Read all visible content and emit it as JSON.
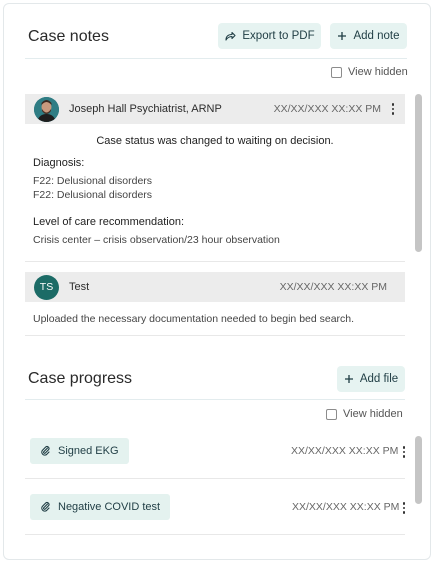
{
  "case_notes": {
    "title": "Case notes",
    "export_label": "Export to PDF",
    "add_note_label": "Add note",
    "view_hidden_label": "View hidden",
    "notes": [
      {
        "author": "Joseph Hall Psychiatrist, ARNP",
        "timestamp": "XX/XX/XXX XX:XX PM",
        "status_text": "Case status was changed to waiting on decision.",
        "diagnosis_heading": "Diagnosis:",
        "diagnoses": [
          "F22: Delusional disorders",
          "F22: Delusional disorders"
        ],
        "care_heading": "Level of care recommendation:",
        "care_value": "Crisis center – crisis observation/23 hour observation"
      },
      {
        "author": "Test",
        "initials": "TS",
        "timestamp": "XX/XX/XXX XX:XX PM",
        "body": "Uploaded the necessary documentation needed to begin bed search."
      }
    ]
  },
  "case_progress": {
    "title": "Case progress",
    "add_file_label": "Add file",
    "view_hidden_label": "View hidden",
    "files": [
      {
        "name": "Signed EKG",
        "timestamp": "XX/XX/XXX XX:XX PM"
      },
      {
        "name": "Negative COVID test",
        "timestamp": "XX/XX/XXX XX:XX PM"
      }
    ]
  },
  "colors": {
    "accent_bg": "#e6f3f1",
    "accent_text": "#1f3d44",
    "avatar_teal": "#1c6b66"
  },
  "icons": {
    "export": "share-arrow-icon",
    "add": "plus-icon",
    "file": "paperclip-icon",
    "menu": "kebab-icon"
  }
}
